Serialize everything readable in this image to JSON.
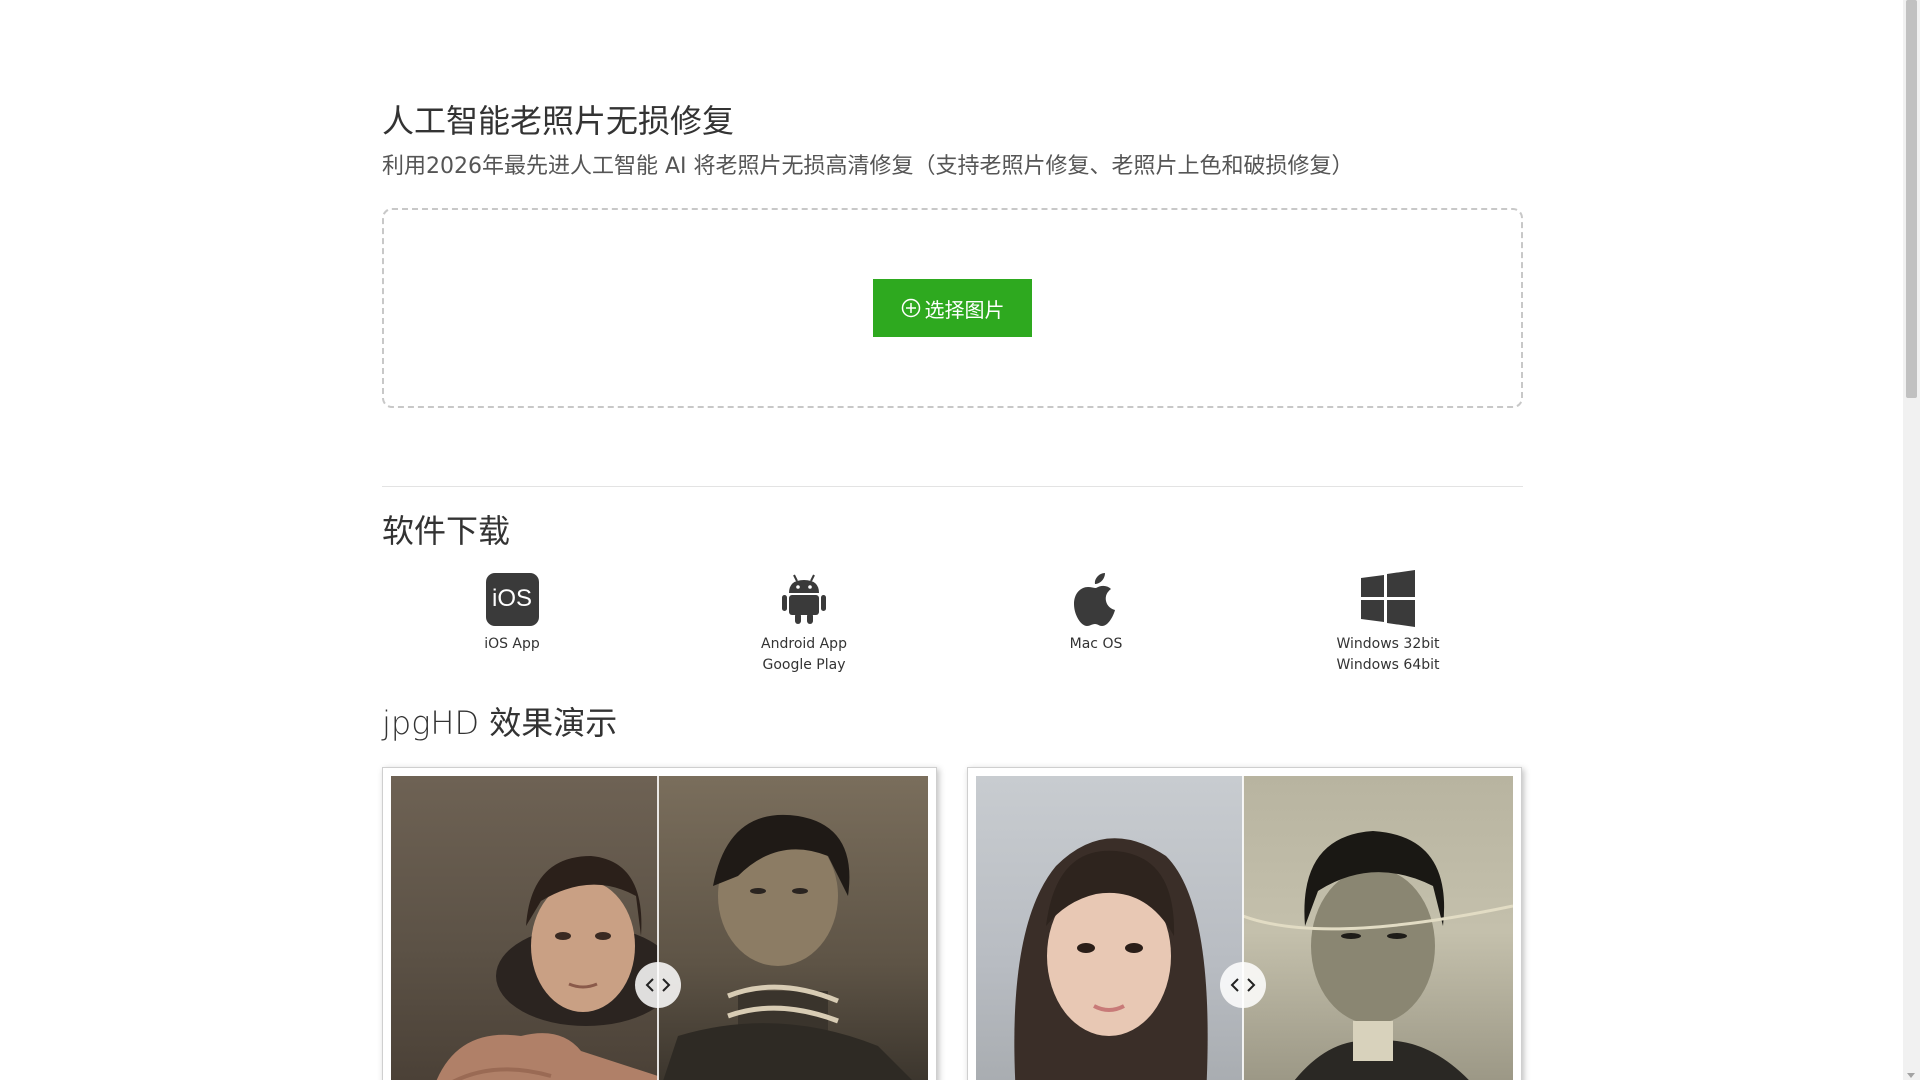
{
  "header": {
    "title": "人工智能老照片无损修复",
    "subtitle": "利用2026年最先进人工智能 AI 将老照片无损高清修复（支持老照片修复、老照片上色和破损修复）"
  },
  "upload": {
    "button_label": "选择图片"
  },
  "downloads": {
    "section_title": "软件下载",
    "items": [
      {
        "icon": "ios-icon",
        "icon_text": "iOS",
        "line1": "iOS App",
        "line2": ""
      },
      {
        "icon": "android-icon",
        "line1": "Android App",
        "line2": "Google Play"
      },
      {
        "icon": "apple-icon",
        "line1": "Mac OS",
        "line2": ""
      },
      {
        "icon": "windows-icon",
        "line1": "Windows 32bit",
        "line2": "Windows 64bit"
      }
    ]
  },
  "demo": {
    "section_title": "jpgHD 效果演示"
  },
  "colors": {
    "accent_green": "#2ea91f",
    "text_dark": "#333333",
    "icon_dark": "#3a3a3a"
  }
}
